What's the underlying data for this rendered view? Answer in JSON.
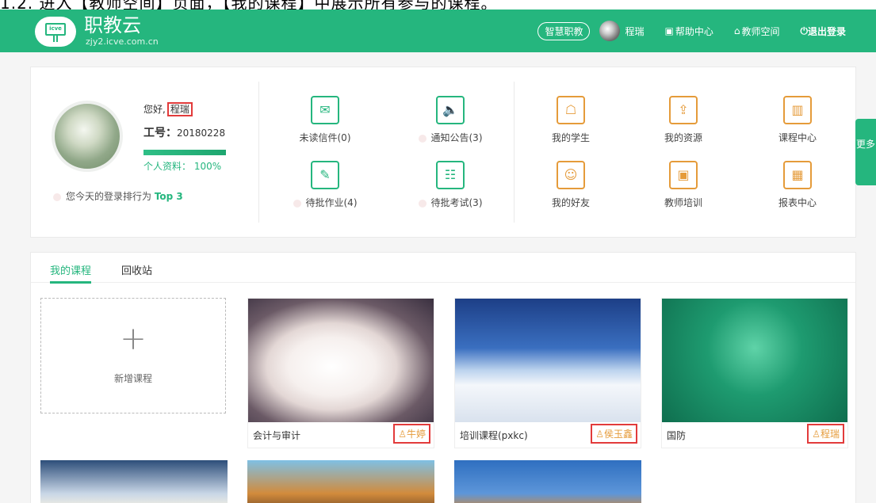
{
  "top_strip": "1.2. 进入【教师空间】页面，【我的课程】中展示所有参与的课程。",
  "header": {
    "brand": "职教云",
    "url": "zjy2.icve.com.cn",
    "logo_text": "icve",
    "nav": {
      "pill": "智慧职教",
      "user": "程瑞",
      "help": "帮助中心",
      "teacher_space": "教师空间",
      "logout": "退出登录"
    },
    "accent": "#25b67e"
  },
  "profile": {
    "greeting": "您好,",
    "name": "程瑞",
    "job_label": "工号：",
    "job_no": "20180228",
    "completion_label": "个人资料：",
    "completion_pct": "100%",
    "completion_value": 1.0,
    "rank_text": "您今天的登录排行为 ",
    "rank_value": "Top 3"
  },
  "quick": {
    "mail": "未读信件(0)",
    "notice": "通知公告(3)",
    "homework": "待批作业(4)",
    "exam": "待批考试(3)",
    "students": "我的学生",
    "resources": "我的资源",
    "course_center": "课程中心",
    "friends": "我的好友",
    "training": "教师培训",
    "reports": "报表中心",
    "more": "更多"
  },
  "courses": {
    "tabs": [
      "我的课程",
      "回收站"
    ],
    "new_course": "新增课程",
    "items": [
      {
        "title": "会计与审计",
        "teacher": "牛婷"
      },
      {
        "title": "培训课程(pxkc)",
        "teacher": "侯玉鑫"
      },
      {
        "title": "国防",
        "teacher": "程瑞"
      }
    ]
  }
}
